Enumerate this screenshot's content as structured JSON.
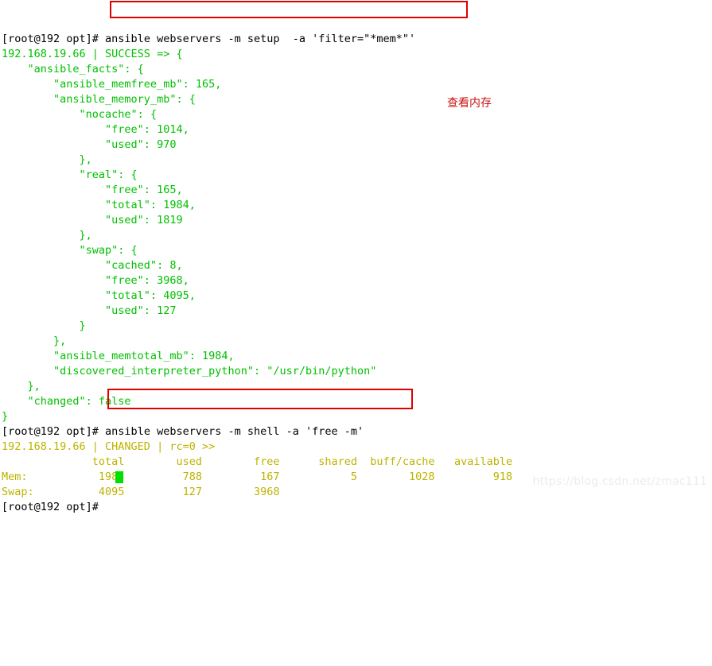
{
  "terminal": {
    "background_color": "#ffffff",
    "prompt_color": "#000000",
    "success_color": "#00c000",
    "table_color": "#bdb300",
    "highlight_color": "#e00000",
    "cursor_color": "#00e000",
    "prompt": "[root@192 opt]#",
    "lines": [
      {
        "id": "l01",
        "segments": [
          {
            "text": "[root@192 opt]#",
            "style": "prompt"
          },
          {
            "text": " ansible webservers -m setup  -a 'filter=\"*mem*\"'",
            "style": "cmd"
          }
        ]
      },
      {
        "id": "l02",
        "segments": [
          {
            "text": "192.168.19.66 | SUCCESS => {",
            "style": "green"
          }
        ]
      },
      {
        "id": "l03",
        "segments": [
          {
            "text": "    \"ansible_facts\": {",
            "style": "green"
          }
        ]
      },
      {
        "id": "l04",
        "segments": [
          {
            "text": "        \"ansible_memfree_mb\": 165,",
            "style": "green"
          }
        ]
      },
      {
        "id": "l05",
        "segments": [
          {
            "text": "        \"ansible_memory_mb\": {",
            "style": "green"
          }
        ]
      },
      {
        "id": "l06",
        "segments": [
          {
            "text": "            \"nocache\": {",
            "style": "green"
          }
        ]
      },
      {
        "id": "l07",
        "segments": [
          {
            "text": "                \"free\": 1014,",
            "style": "green"
          }
        ]
      },
      {
        "id": "l08",
        "segments": [
          {
            "text": "                \"used\": 970",
            "style": "green"
          }
        ]
      },
      {
        "id": "l09",
        "segments": [
          {
            "text": "            },",
            "style": "green"
          }
        ]
      },
      {
        "id": "l10",
        "segments": [
          {
            "text": "            \"real\": {",
            "style": "green"
          }
        ]
      },
      {
        "id": "l11",
        "segments": [
          {
            "text": "                \"free\": 165,",
            "style": "green"
          }
        ]
      },
      {
        "id": "l12",
        "segments": [
          {
            "text": "                \"total\": 1984,",
            "style": "green"
          }
        ]
      },
      {
        "id": "l13",
        "segments": [
          {
            "text": "                \"used\": 1819",
            "style": "green"
          }
        ]
      },
      {
        "id": "l14",
        "segments": [
          {
            "text": "            },",
            "style": "green"
          }
        ]
      },
      {
        "id": "l15",
        "segments": [
          {
            "text": "            \"swap\": {",
            "style": "green"
          }
        ]
      },
      {
        "id": "l16",
        "segments": [
          {
            "text": "                \"cached\": 8,",
            "style": "green"
          }
        ]
      },
      {
        "id": "l17",
        "segments": [
          {
            "text": "                \"free\": 3968,",
            "style": "green"
          }
        ]
      },
      {
        "id": "l18",
        "segments": [
          {
            "text": "                \"total\": 4095,",
            "style": "green"
          }
        ]
      },
      {
        "id": "l19",
        "segments": [
          {
            "text": "                \"used\": 127",
            "style": "green"
          }
        ]
      },
      {
        "id": "l20",
        "segments": [
          {
            "text": "            }",
            "style": "green"
          }
        ]
      },
      {
        "id": "l21",
        "segments": [
          {
            "text": "        },",
            "style": "green"
          }
        ]
      },
      {
        "id": "l22",
        "segments": [
          {
            "text": "        \"ansible_memtotal_mb\": 1984,",
            "style": "green"
          }
        ]
      },
      {
        "id": "l23",
        "segments": [
          {
            "text": "        \"discovered_interpreter_python\": \"/usr/bin/python\"",
            "style": "green"
          }
        ]
      },
      {
        "id": "l24",
        "segments": [
          {
            "text": "    },",
            "style": "green"
          }
        ]
      },
      {
        "id": "l25",
        "segments": [
          {
            "text": "    \"changed\": false",
            "style": "green"
          }
        ]
      },
      {
        "id": "l26",
        "segments": [
          {
            "text": "}",
            "style": "green"
          }
        ]
      },
      {
        "id": "l27",
        "segments": [
          {
            "text": "[root@192 opt]#",
            "style": "prompt"
          },
          {
            "text": " ansible webservers -m shell -a 'free -m'",
            "style": "cmd"
          }
        ]
      },
      {
        "id": "l28",
        "segments": [
          {
            "text": "192.168.19.66 | CHANGED | rc=0 >>",
            "style": "yellow"
          }
        ]
      },
      {
        "id": "l29",
        "segments": [
          {
            "text": "              total        used        free      shared  buff/cache   available",
            "style": "yellow"
          }
        ]
      },
      {
        "id": "l30",
        "segments": [
          {
            "text": "Mem:           1984         788         167           5        1028         918",
            "style": "yellow"
          }
        ]
      },
      {
        "id": "l31",
        "segments": [
          {
            "text": "Swap:          4095         127        3968",
            "style": "yellow"
          }
        ]
      },
      {
        "id": "l32",
        "segments": [
          {
            "text": "[root@192 opt]#",
            "style": "prompt"
          }
        ]
      }
    ]
  },
  "commands": {
    "first": "ansible webservers -m setup  -a 'filter=\"*mem*\"'",
    "second": "ansible webservers -m shell -a 'free -m'"
  },
  "annotation": {
    "text": "查看内存",
    "color": "#cc1111"
  },
  "free_table": {
    "headers": [
      "",
      "total",
      "used",
      "free",
      "shared",
      "buff/cache",
      "available"
    ],
    "rows": [
      {
        "label": "Mem:",
        "total": "1984",
        "used": "788",
        "free": "167",
        "shared": "5",
        "buff_cache": "1028",
        "available": "918"
      },
      {
        "label": "Swap:",
        "total": "4095",
        "used": "127",
        "free": "3968",
        "shared": "",
        "buff_cache": "",
        "available": ""
      }
    ]
  },
  "ansible_facts": {
    "ansible_memfree_mb": 165,
    "ansible_memtotal_mb": 1984,
    "discovered_interpreter_python": "/usr/bin/python",
    "ansible_memory_mb": {
      "nocache": {
        "free": 1014,
        "used": 970
      },
      "real": {
        "free": 165,
        "total": 1984,
        "used": 1819
      },
      "swap": {
        "cached": 8,
        "free": 3968,
        "total": 4095,
        "used": 127
      }
    },
    "changed": "false",
    "host": "192.168.19.66",
    "status_first": "SUCCESS",
    "status_second": "CHANGED",
    "return_code": "rc=0"
  },
  "watermark": {
    "text": "https://blog.csdn.net/zmac111"
  }
}
